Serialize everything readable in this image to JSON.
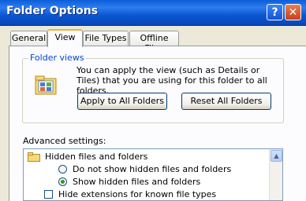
{
  "window": {
    "title": "Folder Options",
    "help_glyph": "?",
    "close_glyph": "✕"
  },
  "tabs": [
    {
      "label": "General"
    },
    {
      "label": "View",
      "active": true
    },
    {
      "label": "File Types"
    },
    {
      "label": "Offline Files"
    }
  ],
  "folder_views": {
    "group_label": "Folder views",
    "description": "You can apply the view (such as Details or Tiles) that you are using for this folder to all folders.",
    "apply_button": "Apply to All Folders",
    "reset_button": "Reset All Folders"
  },
  "advanced": {
    "label": "Advanced settings:",
    "items": [
      {
        "label": "Hidden files and folders",
        "kind": "folder"
      },
      {
        "label": "Do not show hidden files and folders",
        "kind": "radio",
        "selected": false
      },
      {
        "label": "Show hidden files and folders",
        "kind": "radio",
        "selected": true
      },
      {
        "label": "Hide extensions for known file types",
        "kind": "checkbox",
        "checked": false
      }
    ],
    "scroll_up_glyph": "▲"
  }
}
